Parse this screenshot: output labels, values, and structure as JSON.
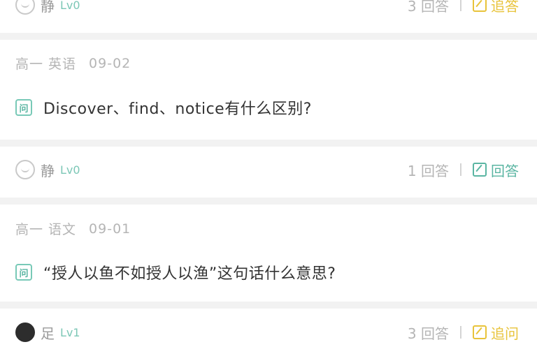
{
  "posts": [
    {
      "footer": {
        "user": "静",
        "level": "Lv0",
        "answers": "3 回答",
        "action": "追答",
        "action_color": "#e8c33a"
      }
    },
    {
      "meta": {
        "subject": "高一 英语",
        "date": "09-02"
      },
      "badge": "问",
      "question": "Discover、find、notice有什么区别?",
      "footer": {
        "user": "静",
        "level": "Lv0",
        "answers": "1 回答",
        "action": "回答",
        "action_color": "#5ab5a2"
      }
    },
    {
      "meta": {
        "subject": "高一 语文",
        "date": "09-01"
      },
      "badge": "问",
      "question": "“授人以鱼不如授人以渔”这句话什么意思?",
      "footer": {
        "user": "足",
        "level": "Lv1",
        "answers": "3 回答",
        "action": "追问",
        "action_color": "#e8c33a"
      }
    }
  ]
}
